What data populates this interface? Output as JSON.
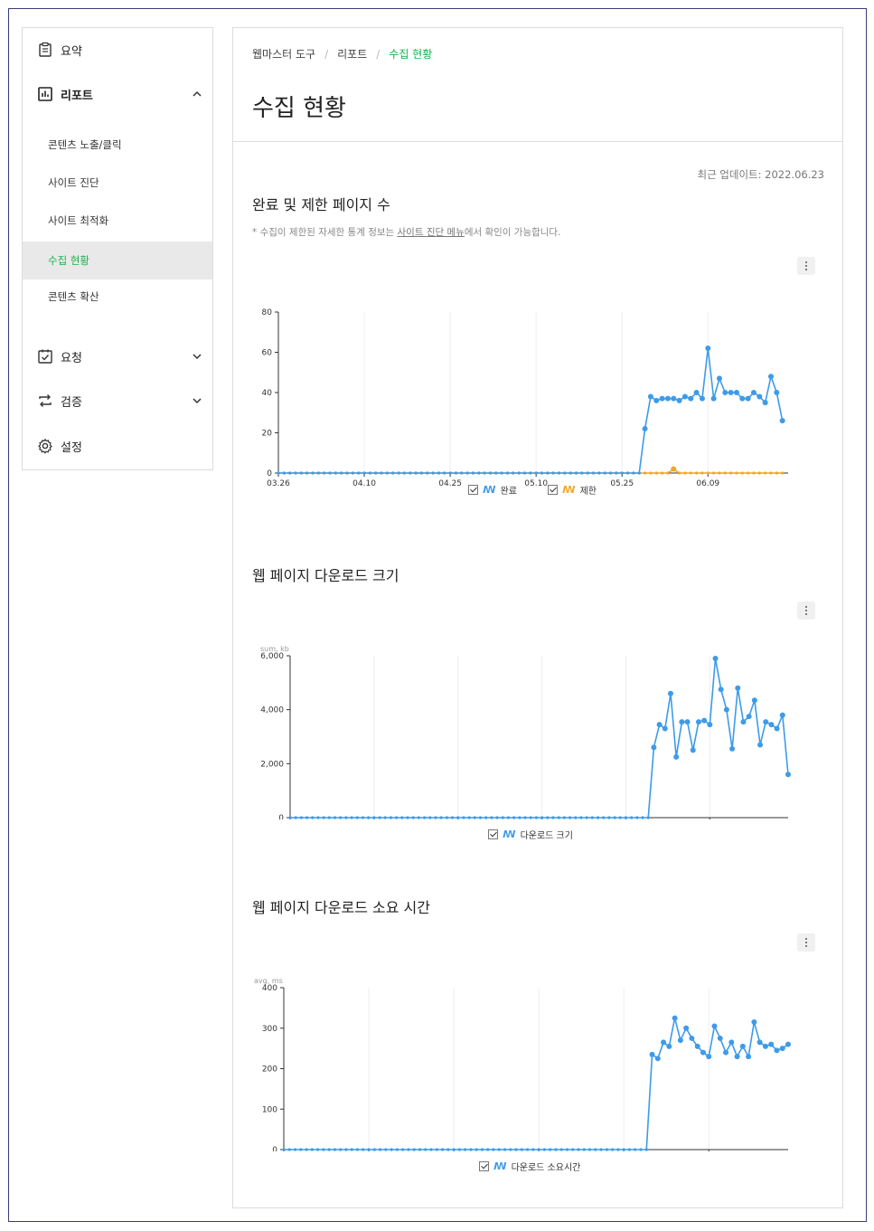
{
  "sidebar": {
    "summary": "요약",
    "report": "리포트",
    "report_items": [
      "콘텐츠 노출/클릭",
      "사이트 진단",
      "사이트 최적화",
      "수집 현황",
      "콘텐츠 확산"
    ],
    "request": "요청",
    "verify": "검증",
    "settings": "설정"
  },
  "breadcrumb": [
    "웹마스터 도구",
    "리포트",
    "수집 현황"
  ],
  "page_title": "수집 현황",
  "updated": "최근 업데이트: 2022.06.23",
  "note": {
    "prefix": "* 수집이 제한된 자세한 통계 정보는 ",
    "link": "사이트 진단 메뉴",
    "suffix": "에서 확인이 가능합니다."
  },
  "colors": {
    "accent": "#19b24a",
    "series_blue": "#3d9be9",
    "series_orange": "#f5a623"
  },
  "chart_data": [
    {
      "type": "line",
      "title": "완료 및 제한 페이지 수",
      "ylabel": "",
      "ylim": [
        0,
        80
      ],
      "yticks": [
        "0",
        "20",
        "40",
        "60",
        "80"
      ],
      "xticks": [
        "03.26",
        "04.10",
        "04.25",
        "05.10",
        "05.25",
        "06.09"
      ],
      "series": [
        {
          "name": "완료",
          "color": "#3d9be9",
          "values": [
            0,
            0,
            0,
            0,
            0,
            0,
            0,
            0,
            0,
            0,
            0,
            0,
            0,
            0,
            0,
            0,
            0,
            0,
            0,
            0,
            0,
            0,
            0,
            0,
            0,
            0,
            0,
            0,
            0,
            0,
            0,
            0,
            0,
            0,
            0,
            0,
            0,
            0,
            0,
            0,
            0,
            0,
            0,
            0,
            0,
            0,
            0,
            0,
            0,
            0,
            0,
            0,
            0,
            0,
            0,
            0,
            0,
            0,
            0,
            0,
            0,
            0,
            0,
            0,
            22,
            38,
            36,
            37,
            37,
            37,
            36,
            38,
            37,
            40,
            37,
            62,
            37,
            47,
            40,
            40,
            40,
            37,
            37,
            40,
            38,
            35,
            48,
            40,
            26
          ]
        },
        {
          "name": "제한",
          "color": "#f5a623",
          "values": [
            0,
            0,
            0,
            0,
            0,
            0,
            0,
            0,
            0,
            0,
            0,
            0,
            0,
            0,
            0,
            0,
            0,
            0,
            0,
            0,
            0,
            0,
            0,
            0,
            0,
            0,
            0,
            0,
            0,
            0,
            0,
            0,
            0,
            0,
            0,
            0,
            0,
            0,
            0,
            0,
            0,
            0,
            0,
            0,
            0,
            0,
            0,
            0,
            0,
            0,
            0,
            0,
            0,
            0,
            0,
            0,
            0,
            0,
            0,
            0,
            0,
            0,
            0,
            0,
            0,
            0,
            0,
            0,
            0,
            2,
            0,
            0,
            0,
            0,
            0,
            0,
            0,
            0,
            0,
            0,
            0,
            0,
            0,
            0,
            0,
            0,
            0,
            0,
            0
          ]
        }
      ]
    },
    {
      "type": "line",
      "title": "웹 페이지 다운로드 크기",
      "unit_label": "sum, kb",
      "ylim": [
        0,
        6000
      ],
      "yticks": [
        "0",
        "2,000",
        "4,000",
        "6,000"
      ],
      "xticks": [
        "03.26",
        "04.10",
        "04.25",
        "05.10",
        "05.25",
        "06.09"
      ],
      "series": [
        {
          "name": "다운로드 크기",
          "color": "#3d9be9",
          "values": [
            0,
            0,
            0,
            0,
            0,
            0,
            0,
            0,
            0,
            0,
            0,
            0,
            0,
            0,
            0,
            0,
            0,
            0,
            0,
            0,
            0,
            0,
            0,
            0,
            0,
            0,
            0,
            0,
            0,
            0,
            0,
            0,
            0,
            0,
            0,
            0,
            0,
            0,
            0,
            0,
            0,
            0,
            0,
            0,
            0,
            0,
            0,
            0,
            0,
            0,
            0,
            0,
            0,
            0,
            0,
            0,
            0,
            0,
            0,
            0,
            0,
            0,
            0,
            0,
            0,
            2600,
            3450,
            3300,
            4600,
            2250,
            3550,
            3550,
            2500,
            3550,
            3600,
            3450,
            5900,
            4750,
            4000,
            2550,
            4800,
            3550,
            3750,
            4350,
            2700,
            3550,
            3450,
            3300,
            3800,
            1600
          ]
        }
      ]
    },
    {
      "type": "line",
      "title": "웹 페이지 다운로드 소요 시간",
      "unit_label": "avg, ms",
      "ylim": [
        0,
        400
      ],
      "yticks": [
        "0",
        "100",
        "200",
        "300",
        "400"
      ],
      "xticks": [
        "03.26",
        "04.10",
        "04.25",
        "05.10",
        "05.25",
        "06.09"
      ],
      "series": [
        {
          "name": "다운로드 소요시간",
          "color": "#3d9be9",
          "values": [
            0,
            0,
            0,
            0,
            0,
            0,
            0,
            0,
            0,
            0,
            0,
            0,
            0,
            0,
            0,
            0,
            0,
            0,
            0,
            0,
            0,
            0,
            0,
            0,
            0,
            0,
            0,
            0,
            0,
            0,
            0,
            0,
            0,
            0,
            0,
            0,
            0,
            0,
            0,
            0,
            0,
            0,
            0,
            0,
            0,
            0,
            0,
            0,
            0,
            0,
            0,
            0,
            0,
            0,
            0,
            0,
            0,
            0,
            0,
            0,
            0,
            0,
            0,
            0,
            0,
            235,
            225,
            265,
            255,
            325,
            270,
            300,
            275,
            255,
            240,
            230,
            305,
            275,
            240,
            265,
            230,
            255,
            230,
            315,
            265,
            255,
            260,
            245,
            250,
            260
          ]
        }
      ]
    }
  ]
}
